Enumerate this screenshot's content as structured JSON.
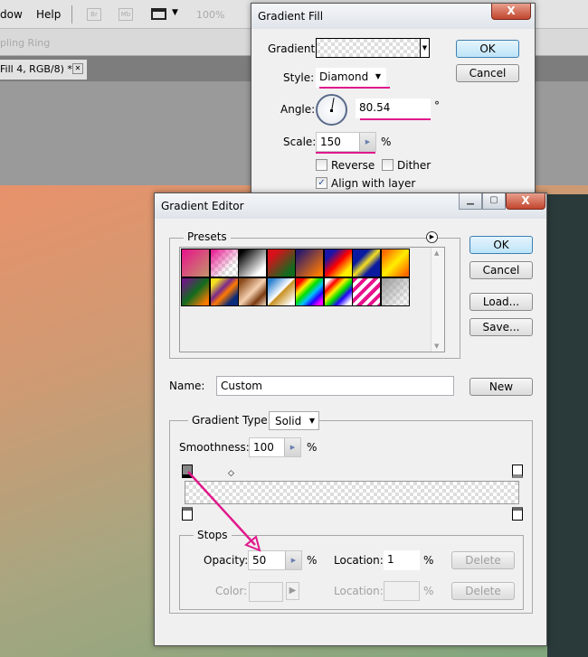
{
  "menubar": {
    "items": [
      "dow",
      "Help"
    ],
    "icons": [
      "Br",
      "Mb"
    ],
    "zoom": "100%"
  },
  "options_bar": {
    "text": "pling Ring"
  },
  "document_tab": {
    "label": "Fill 4, RGB/8) *",
    "close": "✕"
  },
  "gradient_fill": {
    "title": "Gradient Fill",
    "close": "X",
    "gradient_label": "Gradient:",
    "style_label": "Style:",
    "style_value": "Diamond",
    "angle_label": "Angle:",
    "angle_value": "80.54",
    "angle_unit": "°",
    "scale_label": "Scale:",
    "scale_value": "150",
    "scale_unit": "%",
    "reverse_label": "Reverse",
    "reverse_checked": false,
    "dither_label": "Dither",
    "dither_checked": false,
    "align_label": "Align with layer",
    "align_checked": true,
    "ok": "OK",
    "cancel": "Cancel"
  },
  "gradient_editor": {
    "title": "Gradient Editor",
    "close": "X",
    "presets_label": "Presets",
    "presets": [
      "linear-gradient(135deg,#e8118c,#c4956a)",
      "linear-gradient(135deg,#e8118c 0%,rgba(232,17,140,0) 70%)",
      "linear-gradient(135deg,#000 10%,#fff 80%)",
      "linear-gradient(135deg,#d8101a 20%,#126b1e 80%)",
      "linear-gradient(135deg,#2a1a6e 10%,#ff7a00 90%)",
      "linear-gradient(135deg,#1a14a8 20%,#ff0000 50%,#ffee00 80%)",
      "linear-gradient(135deg,#0a1aa0 30%,#f5e020 50%,#0a1aa0 70%)",
      "linear-gradient(135deg,#ff6a00 10%,#ffee00 50%,#ff6a00 90%)",
      "linear-gradient(135deg,#6a1a80 10%,#126b1e 50%,#ff7a00 90%)",
      "linear-gradient(135deg,#f5e020 15%,#7a2a8a 40%,#ff7a00 55%,#0a2a7a 80%)",
      "linear-gradient(135deg,#8a4a1a 10%,#f5d0b0 50%,#7a3a10 75%,#f0d8c0)",
      "linear-gradient(135deg,#2a80d0 10%,#ffffff 48%,#c89020 52%,#ffffff 90%)",
      "linear-gradient(135deg,#ff0000 15%,#ffee00 30%,#00e000 45%,#00c0ff 60%,#2000ff 75%,#ff00ff 90%)",
      "linear-gradient(135deg,#fff 10%,#ff0000 25%,#ffee00 40%,#00e000 55%,#2000ff 70%,#fff 90%)",
      "repeating-linear-gradient(135deg,#e8118c 0 4px,#fff 4px 8px)",
      "linear-gradient(135deg,#999 0%,rgba(200,200,200,0.2) 80%)"
    ],
    "ok": "OK",
    "cancel": "Cancel",
    "load": "Load...",
    "save": "Save...",
    "name_label": "Name:",
    "name_value": "Custom",
    "new": "New",
    "type_label": "Gradient Type:",
    "type_value": "Solid",
    "smooth_label": "Smoothness:",
    "smooth_value": "100",
    "smooth_unit": "%",
    "stops": {
      "label": "Stops",
      "opacity_label": "Opacity:",
      "opacity_value": "50",
      "opacity_unit": "%",
      "opacity_location_label": "Location:",
      "opacity_location_value": "1",
      "opacity_location_unit": "%",
      "delete": "Delete",
      "color_label": "Color:",
      "color_location_label": "Location:",
      "color_location_unit": "%"
    }
  },
  "annotation_color": "#e0198c"
}
